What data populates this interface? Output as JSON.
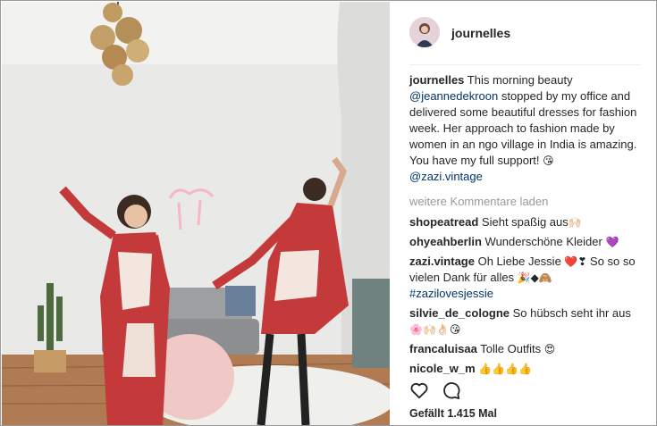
{
  "post": {
    "username": "journelles",
    "avatar_icon": "profile-avatar",
    "caption": {
      "user": "journelles",
      "text_1": " This morning beauty ",
      "mention_1": "@jeannedekroon",
      "text_2": " stopped by my office and delivered some beautiful dresses for fashion week. Her approach to fashion made by women in an ngo village in India is amazing. You have my full support! ",
      "emoji_1": "😘",
      "mention_2": "@zazi.vintage"
    },
    "load_more": "weitere Kommentare laden",
    "comments": [
      {
        "user": "shopeatread",
        "text": " Sieht spaßig aus",
        "emoji": "🙌🏻"
      },
      {
        "user": "ohyeahberlin",
        "text": " Wunderschöne Kleider ",
        "emoji": "💜"
      },
      {
        "user": "zazi.vintage",
        "text": " Oh Liebe Jessie ",
        "emoji": "❤️❣",
        "text_2": " So so so vielen Dank für alles ",
        "emoji_2": "🎉◆🙈",
        "hashtag": "#zazilovesjessie"
      },
      {
        "user": "silvie_de_cologne",
        "text": " So hübsch seht ihr aus ",
        "emoji": "🌸🙌🏻👌🏻😘"
      },
      {
        "user": "francaluisaa",
        "text": " Tolle Outfits ",
        "emoji": "😍"
      },
      {
        "user": "nicole_w_m",
        "text": " ",
        "emoji": "👍👍👍👍"
      }
    ],
    "actions": {
      "like_icon": "heart-icon",
      "comment_icon": "comment-icon"
    },
    "likes": "Gefällt 1.415 Mal"
  }
}
